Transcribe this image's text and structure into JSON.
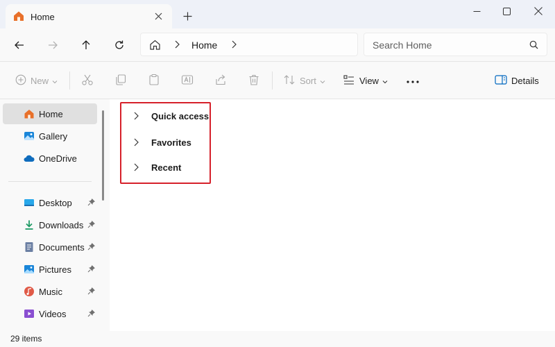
{
  "window": {
    "tab_title": "Home",
    "colors": {
      "accent": "#0067c0",
      "folder_orange": "#e8702a",
      "highlight": "#d6202a"
    }
  },
  "address": {
    "crumbs": [
      "Home"
    ],
    "search_placeholder": "Search Home"
  },
  "toolbar": {
    "new_label": "New",
    "sort_label": "Sort",
    "view_label": "View",
    "details_label": "Details",
    "icons": [
      "cut-icon",
      "copy-icon",
      "paste-icon",
      "rename-icon",
      "share-icon",
      "delete-icon",
      "more-icon"
    ]
  },
  "sidebar": {
    "items": [
      {
        "label": "Home",
        "icon": "home-icon",
        "selected": true
      },
      {
        "label": "Gallery",
        "icon": "gallery-icon"
      },
      {
        "label": "OneDrive",
        "icon": "onedrive-icon"
      },
      {
        "label": "Desktop",
        "icon": "desktop-icon",
        "pinned": true
      },
      {
        "label": "Downloads",
        "icon": "downloads-icon",
        "pinned": true
      },
      {
        "label": "Documents",
        "icon": "documents-icon",
        "pinned": true
      },
      {
        "label": "Pictures",
        "icon": "pictures-icon",
        "pinned": true
      },
      {
        "label": "Music",
        "icon": "music-icon",
        "pinned": true
      },
      {
        "label": "Videos",
        "icon": "videos-icon",
        "pinned": true
      }
    ]
  },
  "main": {
    "sections": [
      {
        "label": "Quick access"
      },
      {
        "label": "Favorites"
      },
      {
        "label": "Recent"
      }
    ]
  },
  "status": {
    "item_count": "29 items"
  }
}
